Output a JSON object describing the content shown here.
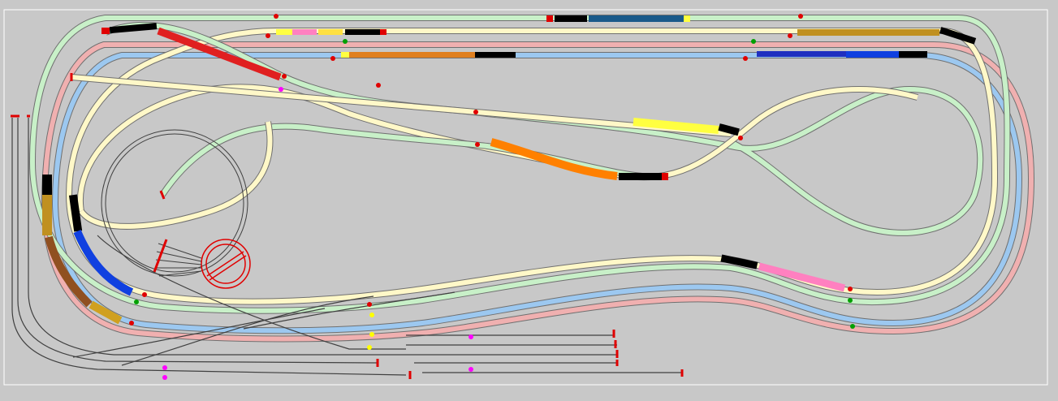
{
  "layout": {
    "colors": {
      "background": "#c8c8c8",
      "panel": "#c8c8c8",
      "panel_border": "#ffffff",
      "track_green": "#c8f0c8",
      "track_yellow": "#fff8c8",
      "track_blue": "#9cc8f0",
      "track_pink": "#f0b0b0",
      "track_siding": "#404040",
      "buffer_stop": "#e00000",
      "turntable": "#e00000"
    },
    "track_lines": [
      "outer-green-loop",
      "outer-yellow-loop",
      "blue-loop",
      "pink-loop",
      "figure-eight-loop",
      "turntable-spur",
      "yard-sidings",
      "lower-left-branch"
    ],
    "trains": [
      {
        "name": "blue-passenger-train",
        "color": "#1a5a8a"
      },
      {
        "name": "yellow-pink-train",
        "color": "#ffe040"
      },
      {
        "name": "orange-freight-train-top",
        "color": "#e08020"
      },
      {
        "name": "gold-freight-train-top-right",
        "color": "#c09020"
      },
      {
        "name": "blue-freight-train-top-right",
        "color": "#2030c0"
      },
      {
        "name": "red-freight-train-top-left",
        "color": "#e02020"
      },
      {
        "name": "yellow-freight-train-center",
        "color": "#ffff40"
      },
      {
        "name": "orange-freight-train-center",
        "color": "#ff8000"
      },
      {
        "name": "pink-freight-train-right",
        "color": "#ff80c0"
      },
      {
        "name": "blue-freight-train-left",
        "color": "#1040e0"
      },
      {
        "name": "brown-freight-train-left",
        "color": "#905020"
      },
      {
        "name": "gold-freight-train-left",
        "color": "#d0a020"
      }
    ]
  }
}
